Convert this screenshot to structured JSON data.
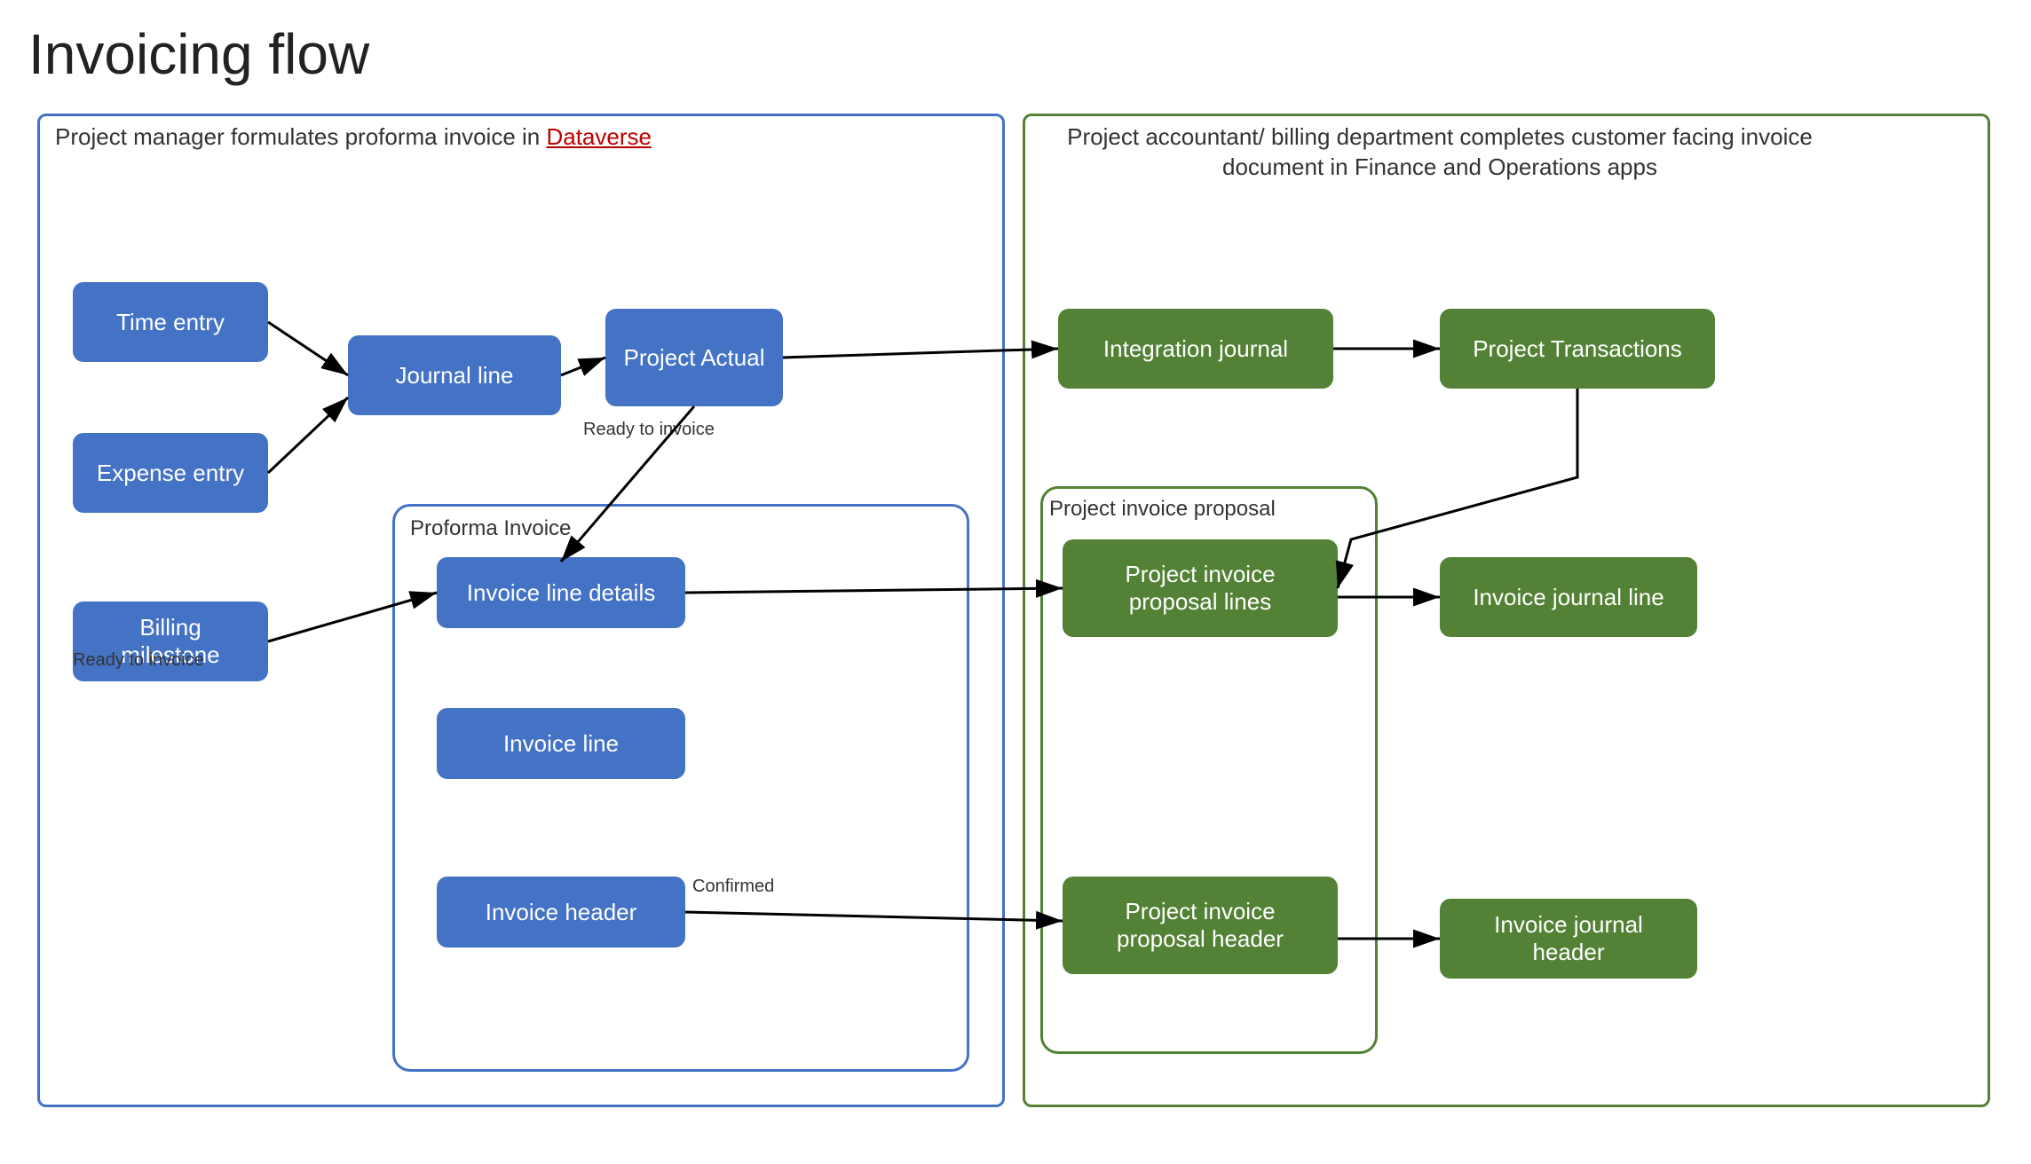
{
  "title": "Invoicing flow",
  "left_panel_label": "Project manager formulates proforma invoice in Dataverse",
  "right_panel_label": "Project accountant/ billing department completes customer facing invoice document in Finance and Operations apps",
  "nodes": {
    "time_entry": "Time entry",
    "expense_entry": "Expense entry",
    "billing_milestone": "Billing milestone",
    "journal_line": "Journal line",
    "project_actual": "Project Actual",
    "proforma_invoice_label": "Proforma Invoice",
    "invoice_line_details": "Invoice line details",
    "invoice_line": "Invoice line",
    "invoice_header": "Invoice header",
    "integration_journal": "Integration journal",
    "project_transactions": "Project Transactions",
    "project_invoice_proposal_label": "Project invoice proposal",
    "project_invoice_proposal_lines": "Project invoice proposal lines",
    "invoice_journal_line": "Invoice journal line",
    "project_invoice_proposal_header": "Project invoice proposal header",
    "invoice_journal_header": "Invoice journal header"
  },
  "arrow_labels": {
    "ready_to_invoice_1": "Ready to invoice",
    "ready_to_invoice_2": "Ready to invoice",
    "confirmed": "Confirmed"
  },
  "colors": {
    "blue": "#4472C4",
    "green": "#538135",
    "text_dark": "#222",
    "arrow": "#000",
    "link_red": "#C00000"
  }
}
